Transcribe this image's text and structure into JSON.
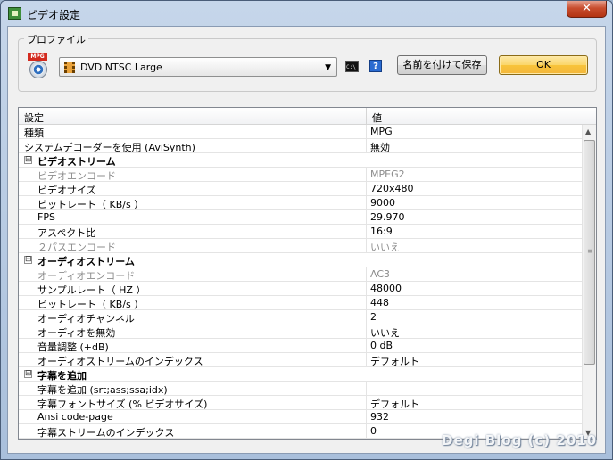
{
  "window": {
    "title": "ビデオ設定",
    "close_symbol": "✕"
  },
  "profile": {
    "legend": "プロファイル",
    "icon_text": "MPG",
    "selected_profile": "DVD NTSC Large",
    "dropdown_arrow": "▼",
    "cmd_icon_text": "C:\\_",
    "help_icon_text": "?",
    "save_as_label": "名前を付けて保存",
    "ok_label": "OK"
  },
  "grid": {
    "columns": {
      "name": "設定",
      "value": "値"
    },
    "rows": [
      {
        "kind": "prop",
        "name": "種類",
        "value": "MPG",
        "indent": false,
        "disabled": false
      },
      {
        "kind": "prop",
        "name": "システムデコーダーを使用 (AviSynth)",
        "value": "無効",
        "indent": false,
        "disabled": false
      },
      {
        "kind": "category",
        "name": "ビデオストリーム",
        "expander": "⊟"
      },
      {
        "kind": "prop",
        "name": "ビデオエンコード",
        "value": "MPEG2",
        "indent": true,
        "disabled": true
      },
      {
        "kind": "prop",
        "name": "ビデオサイズ",
        "value": "720x480",
        "indent": true,
        "disabled": false
      },
      {
        "kind": "prop",
        "name": "ビットレート（ KB/s ）",
        "value": "9000",
        "indent": true,
        "disabled": false
      },
      {
        "kind": "prop",
        "name": "FPS",
        "value": "29.970",
        "indent": true,
        "disabled": false
      },
      {
        "kind": "prop",
        "name": "アスペクト比",
        "value": "16:9",
        "indent": true,
        "disabled": false
      },
      {
        "kind": "prop",
        "name": "２パスエンコード",
        "value": "いいえ",
        "indent": true,
        "disabled": true
      },
      {
        "kind": "category",
        "name": "オーディオストリーム",
        "expander": "⊟"
      },
      {
        "kind": "prop",
        "name": "オーディオエンコード",
        "value": "AC3",
        "indent": true,
        "disabled": true
      },
      {
        "kind": "prop",
        "name": "サンプルレート（ HZ ）",
        "value": "48000",
        "indent": true,
        "disabled": false
      },
      {
        "kind": "prop",
        "name": "ビットレート（ KB/s ）",
        "value": "448",
        "indent": true,
        "disabled": false
      },
      {
        "kind": "prop",
        "name": "オーディオチャンネル",
        "value": "2",
        "indent": true,
        "disabled": false
      },
      {
        "kind": "prop",
        "name": "オーディオを無効",
        "value": "いいえ",
        "indent": true,
        "disabled": false
      },
      {
        "kind": "prop",
        "name": "音量調整 (+dB)",
        "value": "0 dB",
        "indent": true,
        "disabled": false
      },
      {
        "kind": "prop",
        "name": "オーディオストリームのインデックス",
        "value": "デフォルト",
        "indent": true,
        "disabled": false
      },
      {
        "kind": "category",
        "name": "字幕を追加",
        "expander": "⊟"
      },
      {
        "kind": "prop",
        "name": "字幕を追加 (srt;ass;ssa;idx)",
        "value": "",
        "indent": true,
        "disabled": false
      },
      {
        "kind": "prop",
        "name": "字幕フォントサイズ (% ビデオサイズ)",
        "value": "デフォルト",
        "indent": true,
        "disabled": false
      },
      {
        "kind": "prop",
        "name": "Ansi code-page",
        "value": "932",
        "indent": true,
        "disabled": false
      },
      {
        "kind": "prop",
        "name": "字幕ストリームのインデックス",
        "value": "0",
        "indent": true,
        "disabled": false
      }
    ],
    "scroll": {
      "up": "▲",
      "down": "▼",
      "grip": "≡"
    }
  },
  "watermark": "Degi Blog (c) 2010"
}
